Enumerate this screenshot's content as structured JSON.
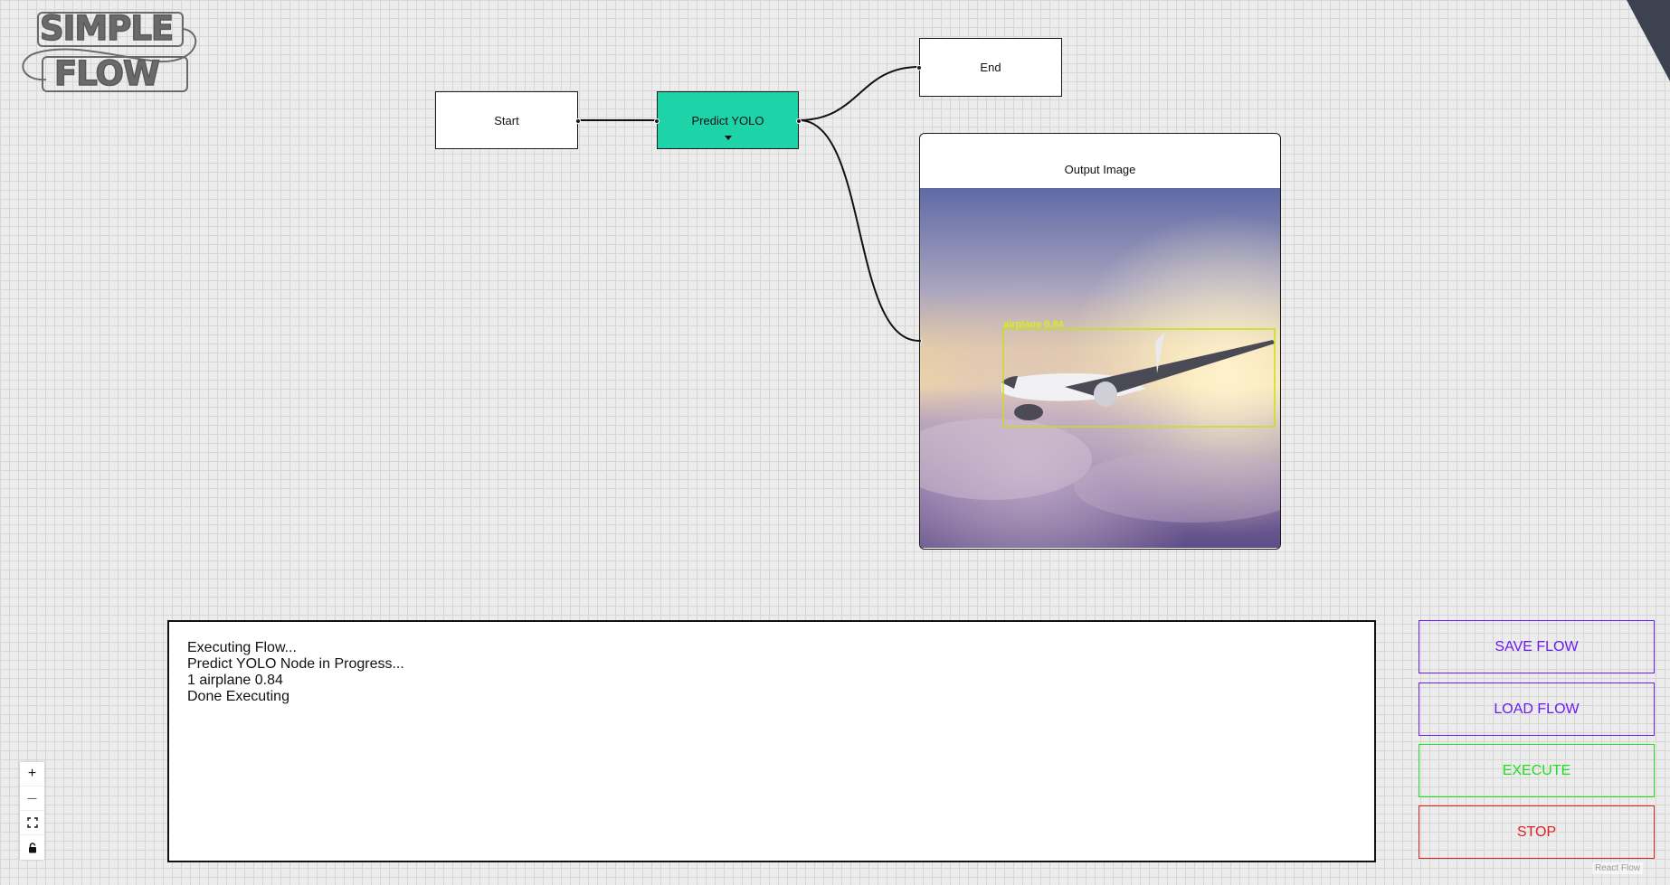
{
  "logo": {
    "line1": "SIMPLE",
    "line2": "FLOW"
  },
  "nodes": {
    "start": "Start",
    "predict": "Predict YOLO",
    "end": "End",
    "output": "Output Image"
  },
  "detection": {
    "label": "airplane 0.84"
  },
  "console": {
    "lines": [
      "Executing Flow...",
      "Predict YOLO Node in Progress...",
      "1 airplane 0.84",
      "Done Executing"
    ]
  },
  "buttons": {
    "save": {
      "label": "SAVE FLOW",
      "color": "#6a1bf0"
    },
    "load": {
      "label": "LOAD FLOW",
      "color": "#6a1bf0"
    },
    "execute": {
      "label": "EXECUTE",
      "color": "#22dd22"
    },
    "stop": {
      "label": "STOP",
      "color": "#e02020"
    }
  },
  "controls": {
    "zoom_in": "+",
    "zoom_out": "—",
    "fit_view": "fit-view-icon",
    "lock": "lock-icon"
  },
  "attribution": "React Flow",
  "colors": {
    "active_node": "#1dd3a7",
    "detection_box": "#c6e01a"
  }
}
